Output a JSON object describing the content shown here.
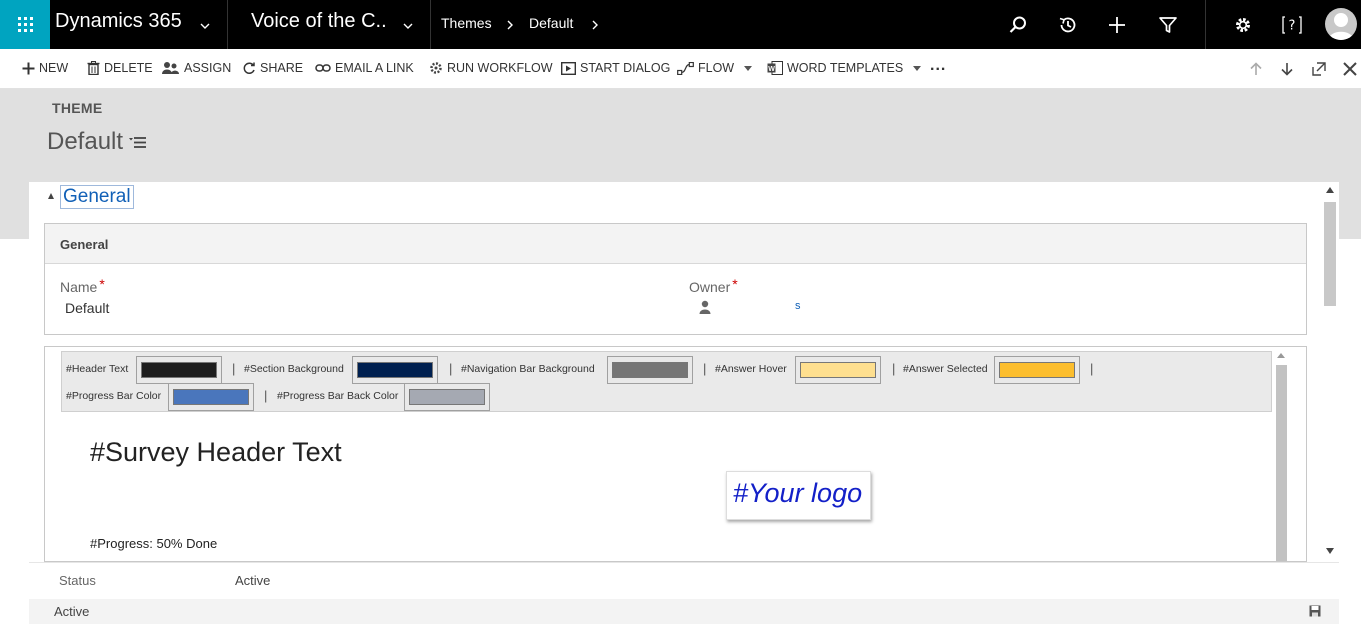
{
  "topbar": {
    "app_name": "Dynamics 365",
    "area_name": "Voice of the C...",
    "breadcrumb": [
      "Themes",
      "Default"
    ],
    "icons": [
      "waffle-icon",
      "search-icon",
      "history-icon",
      "plus-icon",
      "filter-icon",
      "gear-icon",
      "help-icon",
      "user-avatar"
    ],
    "accent": "#00a4c0",
    "background": "#000000"
  },
  "commands": {
    "new": "NEW",
    "delete": "DELETE",
    "assign": "ASSIGN",
    "share": "SHARE",
    "email_link": "EMAIL A LINK",
    "run_workflow": "RUN WORKFLOW",
    "start_dialog": "START DIALOG",
    "flow": "FLOW",
    "word_templates": "WORD TEMPLATES",
    "more": "..."
  },
  "header": {
    "entity_type": "THEME",
    "record_name": "Default"
  },
  "tab": {
    "label": "General"
  },
  "section_general": {
    "title": "General",
    "name_label": "Name",
    "name_value": "Default",
    "owner_label": "Owner",
    "required_mark": "*",
    "owner_value": "s"
  },
  "theme_editor": {
    "palette": [
      {
        "label": "#Header Text",
        "color": "#1e1e1e"
      },
      {
        "label": "#Section Background",
        "color": "#002050"
      },
      {
        "label": "#Navigation Bar Background",
        "color": "#767676"
      },
      {
        "label": "#Answer Hover",
        "color": "#fedf8f"
      },
      {
        "label": "#Answer Selected",
        "color": "#fcbe2e"
      },
      {
        "label": "#Progress Bar Color",
        "color": "#4a76bc"
      },
      {
        "label": "#Progress Bar Back Color",
        "color": "#a5a9b2"
      }
    ],
    "separator": "|",
    "survey_header": "#Survey Header Text",
    "logo_text": "#Your logo",
    "progress_text": "#Progress: 50% Done"
  },
  "footer": {
    "status_label": "Status",
    "status_value": "Active",
    "bar_status": "Active"
  }
}
